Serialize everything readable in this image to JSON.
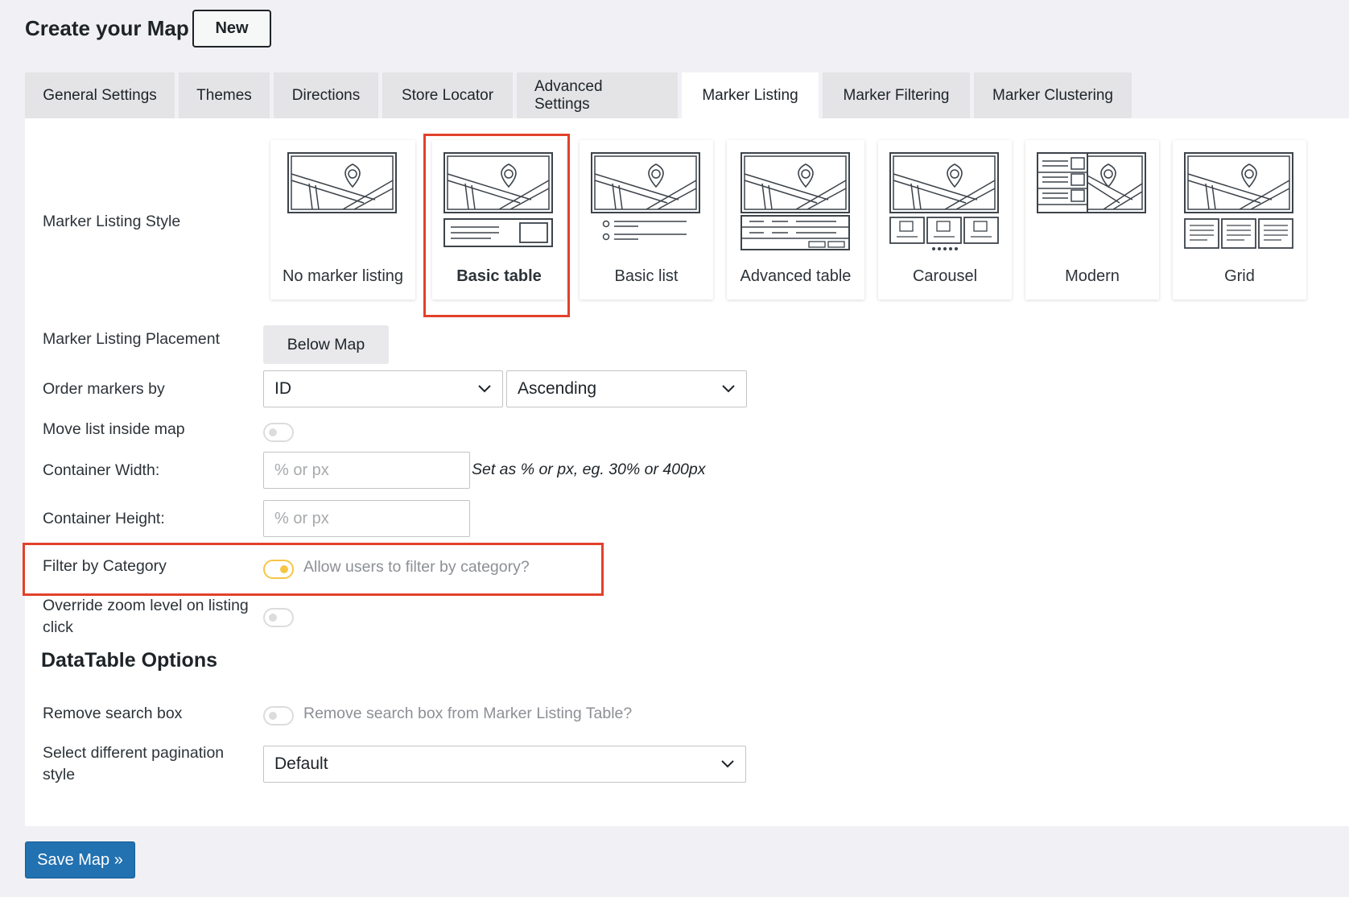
{
  "header": {
    "title": "Create your Map",
    "new_label": "New"
  },
  "tabs": [
    {
      "label": "General Settings",
      "active": false
    },
    {
      "label": "Themes",
      "active": false
    },
    {
      "label": "Directions",
      "active": false
    },
    {
      "label": "Store Locator",
      "active": false
    },
    {
      "label": "Advanced Settings",
      "active": false
    },
    {
      "label": "Marker Listing",
      "active": true
    },
    {
      "label": "Marker Filtering",
      "active": false
    },
    {
      "label": "Marker Clustering",
      "active": false
    }
  ],
  "listing_style": {
    "label": "Marker Listing Style",
    "selected": "Basic table",
    "options": [
      {
        "label": "No marker listing",
        "icon": "map-only-icon"
      },
      {
        "label": "Basic table",
        "icon": "basic-table-icon"
      },
      {
        "label": "Basic list",
        "icon": "basic-list-icon"
      },
      {
        "label": "Advanced table",
        "icon": "advanced-table-icon"
      },
      {
        "label": "Carousel",
        "icon": "carousel-icon"
      },
      {
        "label": "Modern",
        "icon": "modern-icon"
      },
      {
        "label": "Grid",
        "icon": "grid-icon"
      }
    ]
  },
  "placement": {
    "label": "Marker Listing Placement",
    "value": "Below Map"
  },
  "order": {
    "label": "Order markers by",
    "field": "ID",
    "direction": "Ascending"
  },
  "move_inside": {
    "label": "Move list inside map",
    "enabled": false
  },
  "container_width": {
    "label": "Container Width:",
    "placeholder": "% or px",
    "hint": "Set as % or px, eg. 30% or 400px"
  },
  "container_height": {
    "label": "Container Height:",
    "placeholder": "% or px"
  },
  "filter_category": {
    "label": "Filter by Category",
    "enabled": true,
    "description": "Allow users to filter by category?"
  },
  "override_zoom": {
    "label_line1": "Override zoom level on listing",
    "label_line2": "click",
    "enabled": false
  },
  "datatable": {
    "title": "DataTable Options",
    "remove_search": {
      "label": "Remove search box",
      "enabled": false,
      "description": "Remove search box from Marker Listing Table?"
    },
    "pagination": {
      "label_line1": "Select different pagination",
      "label_line2": "style",
      "value": "Default"
    }
  },
  "save_label": "Save Map »",
  "colors": {
    "accent": "#2271b1",
    "highlight": "#e2412b",
    "toggle_on": "#f6c544"
  }
}
